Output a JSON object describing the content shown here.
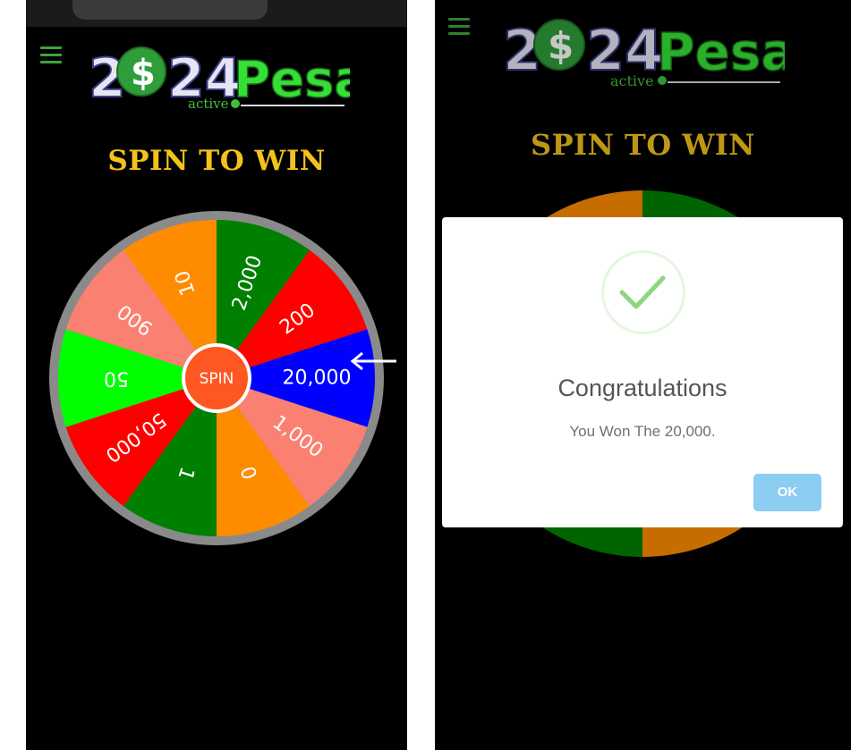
{
  "logo": {
    "digits_left": "2",
    "digits_right": "24",
    "brand": "Pesa",
    "tagline": "active",
    "dollar_glyph": "$"
  },
  "title": "SPIN TO WIN",
  "spin_button_label": "SPIN",
  "wheel": {
    "segments": [
      {
        "label": "2,000",
        "color": "#008000"
      },
      {
        "label": "200",
        "color": "#ff0000"
      },
      {
        "label": "20,000",
        "color": "#0000ff"
      },
      {
        "label": "1,000",
        "color": "#fa8072"
      },
      {
        "label": "0",
        "color": "#ff8c00"
      },
      {
        "label": "1",
        "color": "#008000"
      },
      {
        "label": "50,000",
        "color": "#ff0000"
      },
      {
        "label": "50",
        "color": "#00ff00"
      },
      {
        "label": "900",
        "color": "#fa8072"
      },
      {
        "label": "10",
        "color": "#ff8c00"
      }
    ],
    "winning_label": "20,000"
  },
  "dialog": {
    "title": "Congratulations",
    "message": "You Won The 20,000.",
    "ok_label": "OK",
    "check_color": "#8ed77e"
  },
  "colors": {
    "menu": "#3fa33f",
    "title": "#f4c21b",
    "ring": "#8a8a8a",
    "spin_button": "#ff5722",
    "ok_button": "#8ccdf2"
  }
}
